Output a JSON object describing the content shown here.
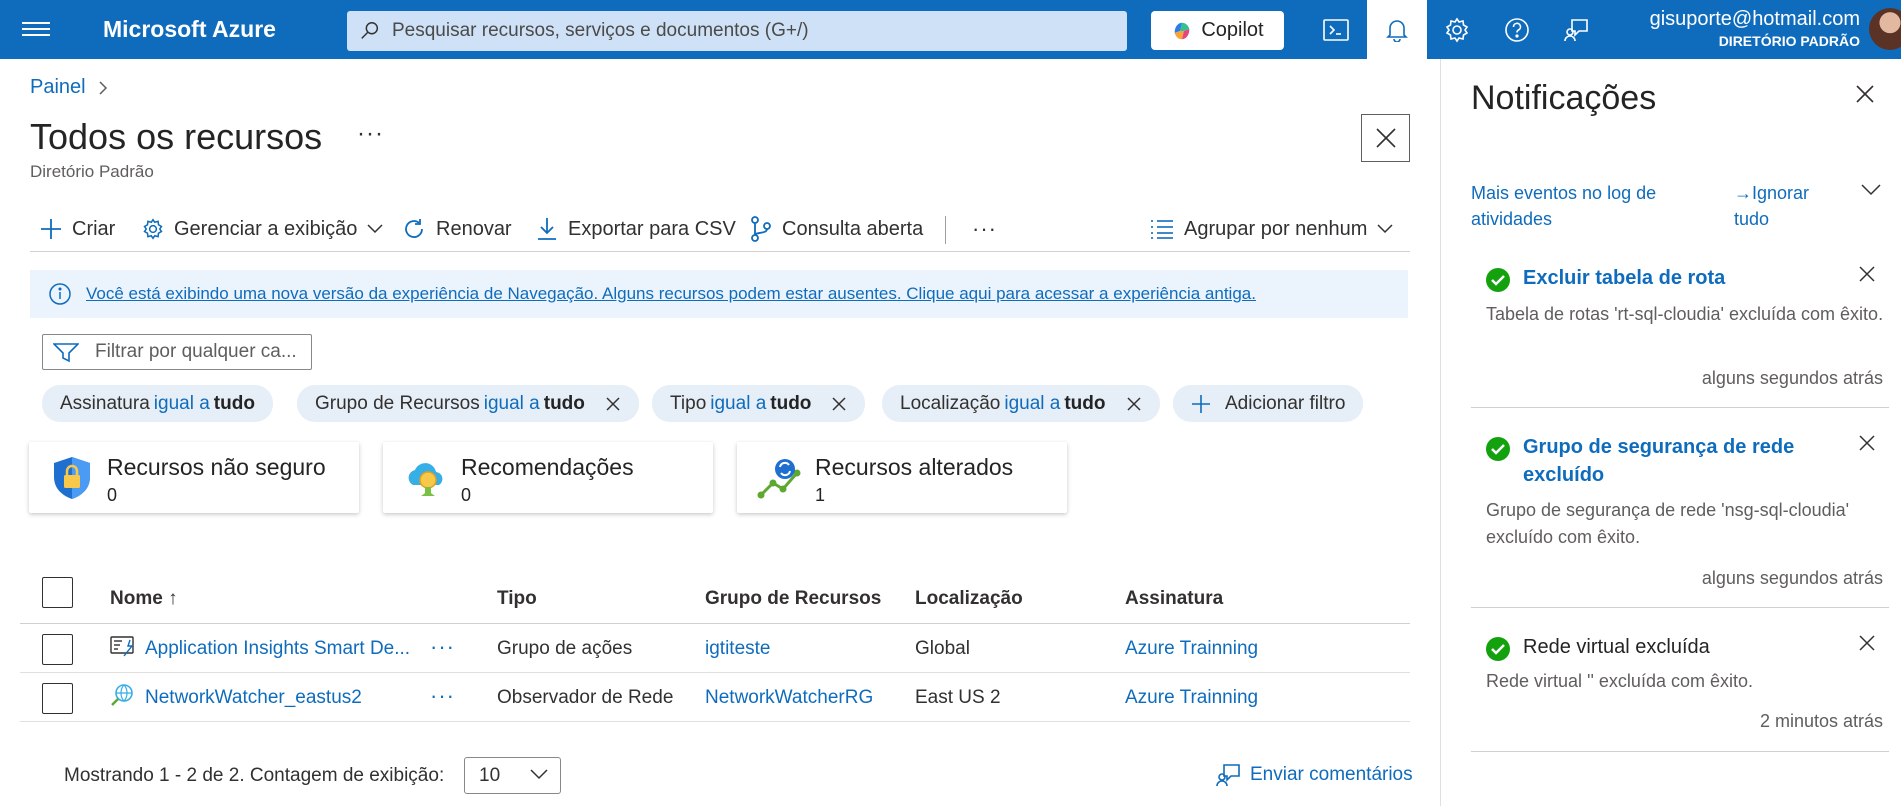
{
  "topbar": {
    "brand": "Microsoft Azure",
    "search_placeholder": "Pesquisar recursos, serviços e documentos (G+/)",
    "copilot_label": "Copilot",
    "user_email": "gisuporte@hotmail.com",
    "user_directory": "DIRETÓRIO PADRÃO",
    "accent": "#0f6cbd"
  },
  "breadcrumb": {
    "root": "Painel"
  },
  "page": {
    "title": "Todos os recursos",
    "more": "···",
    "subtitle": "Diretório Padrão"
  },
  "toolbar": {
    "create": "Criar",
    "manage_view": "Gerenciar a exibição",
    "refresh": "Renovar",
    "export_csv": "Exportar para CSV",
    "open_query": "Consulta aberta",
    "more": "···",
    "group_by": "Agrupar por nenhum"
  },
  "infobar": {
    "message": "Você está exibindo uma nova versão da experiência de Navegação. Alguns recursos podem estar ausentes. Clique aqui para acessar a experiência antiga."
  },
  "filter": {
    "placeholder": "Filtrar por qualquer ca...",
    "pills": [
      {
        "field": "Assinatura",
        "op": "igual a",
        "value": "tudo"
      },
      {
        "field": "Grupo de Recursos",
        "op": "igual a",
        "value": "tudo"
      },
      {
        "field": "Tipo",
        "op": "igual a",
        "value": "tudo"
      },
      {
        "field": "Localização",
        "op": "igual a",
        "value": "tudo"
      }
    ],
    "add_filter": "Adicionar filtro"
  },
  "cards": [
    {
      "title": "Recursos não seguro",
      "value": "0",
      "icon": "shield-lock-icon"
    },
    {
      "title": "Recomendações",
      "value": "0",
      "icon": "advisor-cloud-icon"
    },
    {
      "title": "Recursos alterados",
      "value": "1",
      "icon": "resource-changes-icon"
    }
  ],
  "table": {
    "columns": [
      "Nome ↑",
      "Tipo",
      "Grupo de Recursos",
      "Localização",
      "Assinatura"
    ],
    "rows": [
      {
        "name": "Application Insights Smart De...",
        "type": "Grupo de ações",
        "group": "igtiteste",
        "location": "Global",
        "subscription": "Azure Trainning",
        "icon": "action-group-icon"
      },
      {
        "name": "NetworkWatcher_eastus2",
        "type": "Observador de Rede",
        "group": "NetworkWatcherRG",
        "location": "East US 2",
        "subscription": "Azure Trainning",
        "icon": "network-watcher-icon"
      }
    ],
    "row_more": "···"
  },
  "footer": {
    "showing": "Mostrando 1 - 2 de 2. Contagem de exibição:",
    "page_size": "10",
    "feedback": "Enviar comentários"
  },
  "notifications": {
    "title": "Notificações",
    "more_events": "Mais eventos no log de atividades",
    "ignore_all": "→Ignorar tudo",
    "items": [
      {
        "title": "Excluir tabela de rota",
        "body": "Tabela de rotas 'rt-sql-cloudia' excluída com êxito.",
        "time": "alguns segundos atrás"
      },
      {
        "title": "Grupo de segurança de rede excluído",
        "body": "Grupo de segurança de rede 'nsg-sql-cloudia' excluído com êxito.",
        "time": "alguns segundos atrás"
      },
      {
        "title": "Rede virtual excluída",
        "body": "Rede virtual '' excluída com êxito.",
        "time": "2 minutos atrás"
      }
    ],
    "success_color": "#13a10e"
  }
}
